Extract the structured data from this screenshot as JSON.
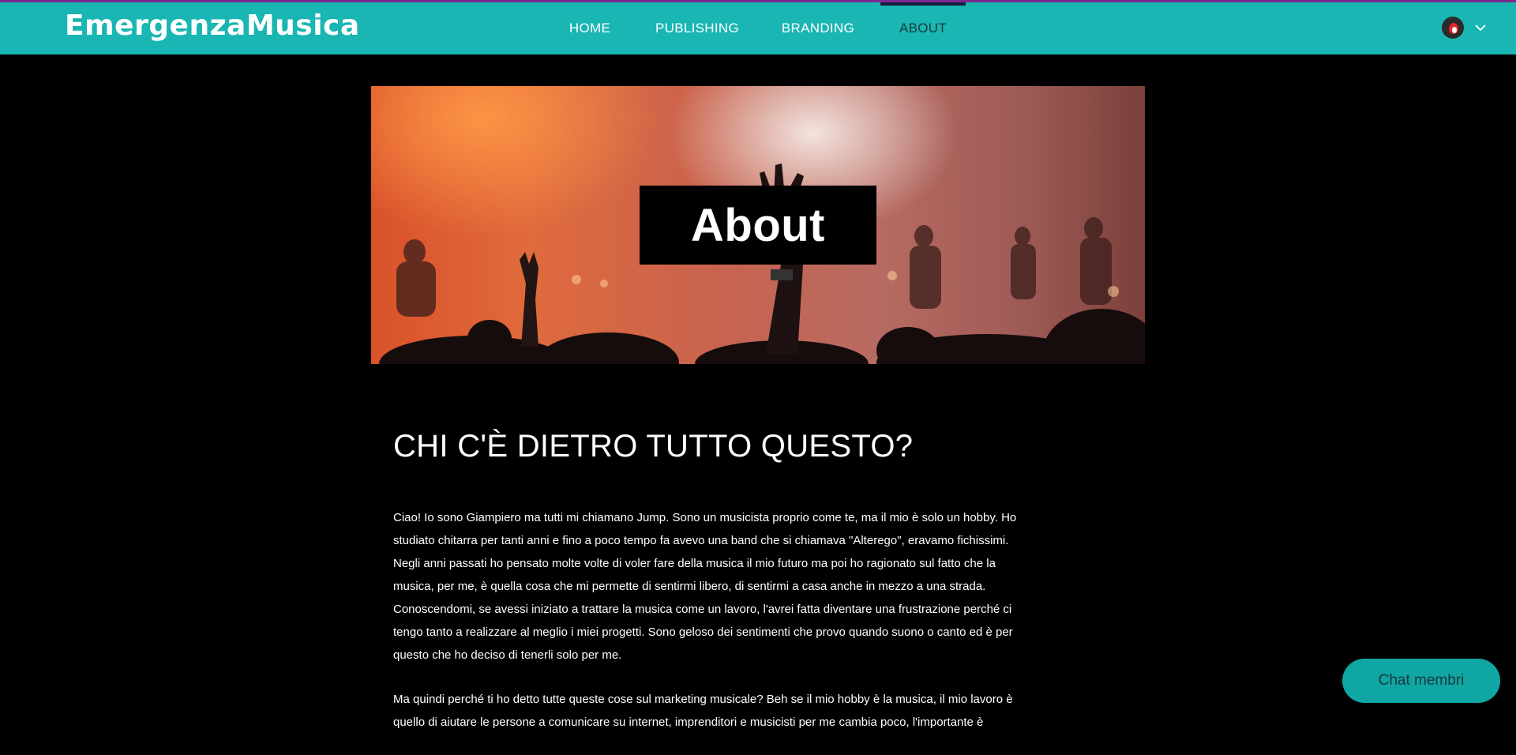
{
  "site": {
    "logo_text": "EmergenzaMusica"
  },
  "nav": {
    "items": [
      {
        "label": "HOME"
      },
      {
        "label": "PUBLISHING"
      },
      {
        "label": "BRANDING"
      },
      {
        "label": "ABOUT",
        "active": true
      }
    ]
  },
  "user": {
    "avatar_icon": "flame-avatar-icon",
    "menu_icon": "chevron-down-icon"
  },
  "hero": {
    "title": "About"
  },
  "content": {
    "heading": "CHI C'È DIETRO TUTTO QUESTO?",
    "paragraphs": [
      "Ciao! Io sono Giampiero ma tutti mi chiamano Jump. Sono un musicista proprio come te, ma il mio è solo un hobby. Ho studiato chitarra per tanti anni e fino a poco tempo fa avevo una band che si chiamava \"Alterego\", eravamo fichissimi. Negli anni passati ho pensato molte volte di voler fare della musica il mio futuro ma poi ho ragionato sul fatto che la musica, per me, è quella cosa che mi permette di sentirmi libero, di sentirmi a casa anche in mezzo a una strada. Conoscendomi, se avessi iniziato a trattare la musica come un lavoro, l'avrei fatta diventare una frustrazione perché ci tengo tanto a realizzare al meglio i miei progetti.  Sono geloso dei sentimenti che provo quando suono o canto ed è per questo che ho deciso di tenerli solo per me.",
      "Ma quindi perché ti ho detto tutte queste cose sul marketing musicale? Beh se il mio hobby è la musica, il mio lavoro è quello di aiutare le persone a comunicare su internet, imprenditori e musicisti per me cambia poco, l'importante è"
    ]
  },
  "chat": {
    "label": "Chat membri"
  },
  "colors": {
    "header": "#19b6b3",
    "chat_button": "#0fa6a4",
    "background": "#000000"
  }
}
